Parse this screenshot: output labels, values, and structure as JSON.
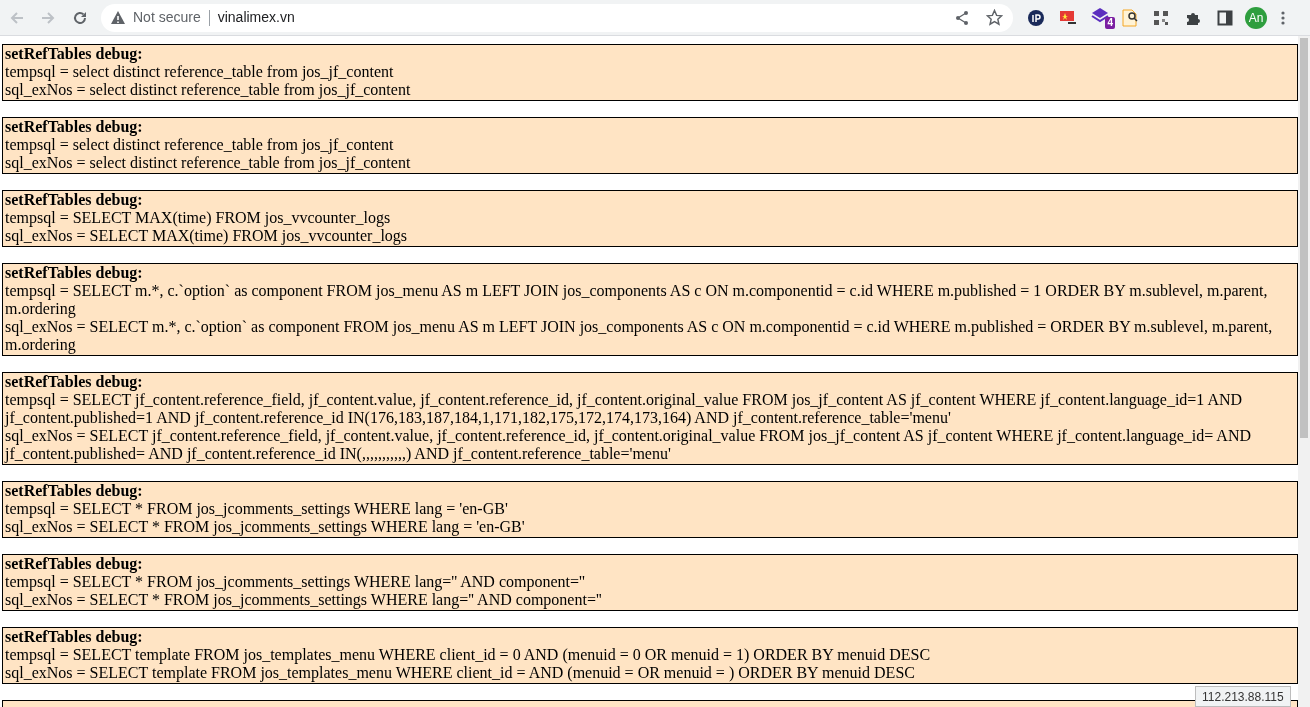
{
  "browser": {
    "security_label": "Not secure",
    "url": "vinalimex.vn",
    "extension_badge": "4",
    "profile_initials": "An"
  },
  "debug_blocks": [
    {
      "title": "setRefTables debug:",
      "lines": [
        "tempsql = select distinct reference_table from jos_jf_content",
        "sql_exNos = select distinct reference_table from jos_jf_content"
      ]
    },
    {
      "title": "setRefTables debug:",
      "lines": [
        "tempsql = select distinct reference_table from jos_jf_content",
        "sql_exNos = select distinct reference_table from jos_jf_content"
      ]
    },
    {
      "title": "setRefTables debug:",
      "lines": [
        "tempsql = SELECT MAX(time) FROM jos_vvcounter_logs",
        "sql_exNos = SELECT MAX(time) FROM jos_vvcounter_logs"
      ]
    },
    {
      "title": "setRefTables debug:",
      "lines": [
        "tempsql = SELECT m.*, c.`option` as component FROM jos_menu AS m LEFT JOIN jos_components AS c ON m.componentid = c.id WHERE m.published = 1 ORDER BY m.sublevel, m.parent, m.ordering",
        "sql_exNos = SELECT m.*, c.`option` as component FROM jos_menu AS m LEFT JOIN jos_components AS c ON m.componentid = c.id WHERE m.published = ORDER BY m.sublevel, m.parent, m.ordering"
      ]
    },
    {
      "title": "setRefTables debug:",
      "lines": [
        "tempsql = SELECT jf_content.reference_field, jf_content.value, jf_content.reference_id, jf_content.original_value FROM jos_jf_content AS jf_content WHERE jf_content.language_id=1 AND jf_content.published=1 AND jf_content.reference_id IN(176,183,187,184,1,171,182,175,172,174,173,164) AND jf_content.reference_table='menu'",
        "sql_exNos = SELECT jf_content.reference_field, jf_content.value, jf_content.reference_id, jf_content.original_value FROM jos_jf_content AS jf_content WHERE jf_content.language_id= AND jf_content.published= AND jf_content.reference_id IN(,,,,,,,,,,,) AND jf_content.reference_table='menu'"
      ]
    },
    {
      "title": "setRefTables debug:",
      "lines": [
        "tempsql = SELECT * FROM jos_jcomments_settings WHERE lang = 'en-GB'",
        "sql_exNos = SELECT * FROM jos_jcomments_settings WHERE lang = 'en-GB'"
      ]
    },
    {
      "title": "setRefTables debug:",
      "lines": [
        "tempsql = SELECT * FROM jos_jcomments_settings WHERE lang='' AND component=''",
        "sql_exNos = SELECT * FROM jos_jcomments_settings WHERE lang='' AND component=''"
      ]
    },
    {
      "title": "setRefTables debug:",
      "lines": [
        "tempsql = SELECT template FROM jos_templates_menu WHERE client_id = 0 AND (menuid = 0 OR menuid = 1) ORDER BY menuid DESC",
        "sql_exNos = SELECT template FROM jos_templates_menu WHERE client_id = AND (menuid = OR menuid = ) ORDER BY menuid DESC"
      ]
    },
    {
      "kind": "cut_off_box"
    }
  ],
  "status_bubble": "112.213.88.115"
}
